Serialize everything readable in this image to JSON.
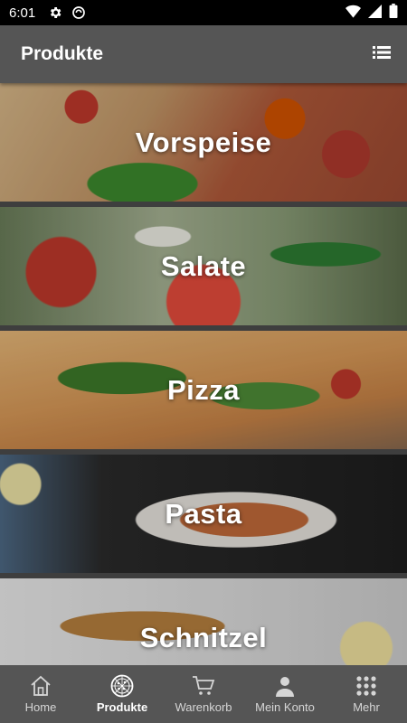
{
  "status_bar": {
    "time": "6:01",
    "icons": [
      "settings-icon",
      "sync-icon",
      "wifi-icon",
      "signal-icon",
      "battery-icon"
    ]
  },
  "app_bar": {
    "title": "Produkte",
    "action_icon": "list-icon"
  },
  "categories": [
    {
      "label": "Vorspeise"
    },
    {
      "label": "Salate"
    },
    {
      "label": "Pizza"
    },
    {
      "label": "Pasta"
    },
    {
      "label": "Schnitzel"
    }
  ],
  "bottom_nav": {
    "items": [
      {
        "label": "Home",
        "icon": "home-icon",
        "active": false
      },
      {
        "label": "Produkte",
        "icon": "pizza-icon",
        "active": true
      },
      {
        "label": "Warenkorb",
        "icon": "cart-icon",
        "active": false
      },
      {
        "label": "Mein Konto",
        "icon": "person-icon",
        "active": false
      },
      {
        "label": "Mehr",
        "icon": "grid-icon",
        "active": false
      }
    ]
  },
  "colors": {
    "app_bar": "#555555",
    "status_bar": "#000000",
    "nav_active": "#ffffff",
    "nav_inactive": "#d6d6d6"
  }
}
